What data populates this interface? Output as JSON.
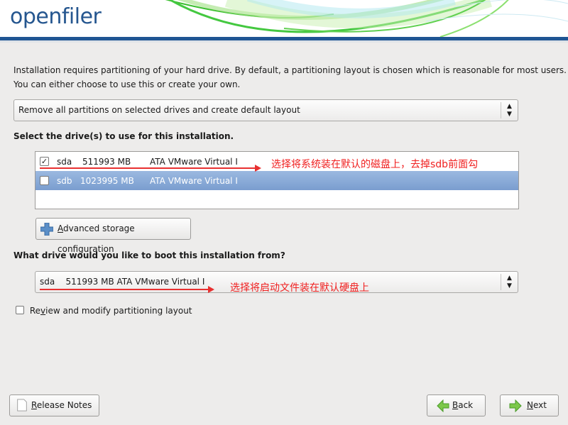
{
  "header": {
    "logo": "openfiler"
  },
  "intro": {
    "line1": "Installation requires partitioning of your hard drive.  By default, a partitioning layout is chosen which is reasonable for most users.",
    "line2": "You can either choose to use this or create your own."
  },
  "layout_select": {
    "value": "Remove all partitions on selected drives and create default layout"
  },
  "drives_label": "Select the drive(s) to use for this installation.",
  "drives": [
    {
      "checked": true,
      "name": "sda",
      "size": "511993 MB",
      "model": "ATA VMware Virtual I",
      "selected": false
    },
    {
      "checked": false,
      "name": "sdb",
      "size": "1023995 MB",
      "model": "ATA VMware Virtual I",
      "selected": true
    }
  ],
  "annotation1": "选择将系统装在默认的磁盘上，去掉sdb前面勾",
  "advanced_button": {
    "mnemonic": "A",
    "rest": "dvanced storage configuration"
  },
  "boot_label": "What drive would you like to boot this installation from?",
  "boot_select": {
    "value": "sda    511993 MB ATA VMware Virtual I"
  },
  "annotation2": "选择将启动文件装在默认硬盘上",
  "review": {
    "checked": false,
    "pre": "Re",
    "mnemonic": "v",
    "rest": "iew and modify partitioning layout"
  },
  "buttons": {
    "release": {
      "mnemonic": "R",
      "rest": "elease Notes"
    },
    "back": {
      "mnemonic": "B",
      "rest": "ack"
    },
    "next": {
      "mnemonic": "N",
      "rest": "ext"
    }
  },
  "colors": {
    "brand": "#1f5593",
    "selection": "#86a8d6",
    "annotation": "#f02020"
  }
}
